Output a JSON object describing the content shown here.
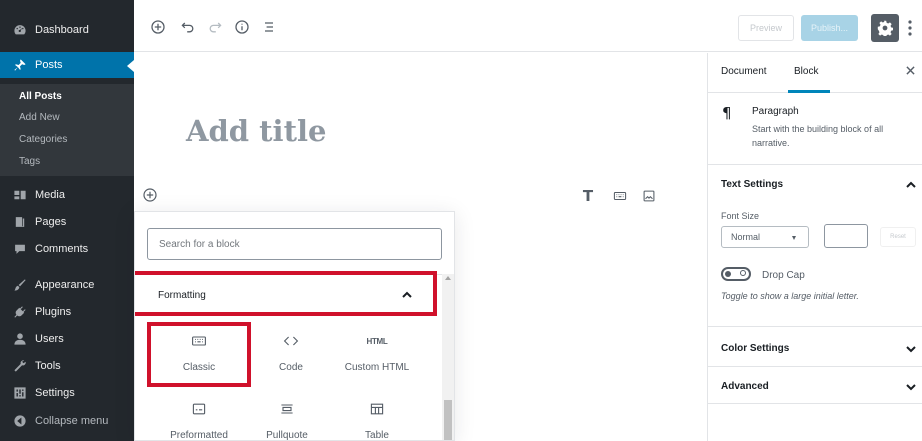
{
  "colors": {
    "sidebar_bg": "#23282d",
    "submenu_bg": "#32373c",
    "accent": "#0073aa",
    "highlight_red": "#d0112b",
    "publish_btn": "#a8d3e6"
  },
  "admin_menu": {
    "dashboard": "Dashboard",
    "posts": "Posts",
    "posts_submenu": [
      "All Posts",
      "Add New",
      "Categories",
      "Tags"
    ],
    "media": "Media",
    "pages": "Pages",
    "comments": "Comments",
    "appearance": "Appearance",
    "plugins": "Plugins",
    "users": "Users",
    "tools": "Tools",
    "settings": "Settings",
    "collapse": "Collapse menu"
  },
  "toolbar": {
    "icons": [
      "add-block-icon",
      "undo-icon",
      "redo-icon",
      "info-icon",
      "block-navigation-icon"
    ],
    "preview_label": "Preview",
    "publish_label": "Publish...",
    "settings_icon": "gear-icon",
    "more_icon": "vertical-ellipsis-icon"
  },
  "editor": {
    "title_placeholder": "Add title",
    "block_toolbar_letter": "T"
  },
  "inserter": {
    "search_placeholder": "Search for a block",
    "section_label": "Formatting",
    "blocks": [
      {
        "label": "Classic",
        "icon": "keyboard-icon"
      },
      {
        "label": "Code",
        "icon": "code-icon"
      },
      {
        "label": "Custom HTML",
        "icon": "html-icon",
        "icon_text": "HTML"
      },
      {
        "label": "Preformatted",
        "icon": "preformatted-icon"
      },
      {
        "label": "Pullquote",
        "icon": "pullquote-icon"
      },
      {
        "label": "Table",
        "icon": "table-icon"
      }
    ]
  },
  "settings_panel": {
    "tab_document": "Document",
    "tab_block": "Block",
    "close_icon": "close-icon",
    "block_icon": "¶",
    "block_name": "Paragraph",
    "block_desc": "Start with the building block of all narrative.",
    "text_settings": "Text Settings",
    "font_size_label": "Font Size",
    "font_size_value": "Normal",
    "reset_label": "Reset",
    "drop_cap_label": "Drop Cap",
    "drop_cap_help": "Toggle to show a large initial letter.",
    "color_settings": "Color Settings",
    "advanced": "Advanced"
  }
}
